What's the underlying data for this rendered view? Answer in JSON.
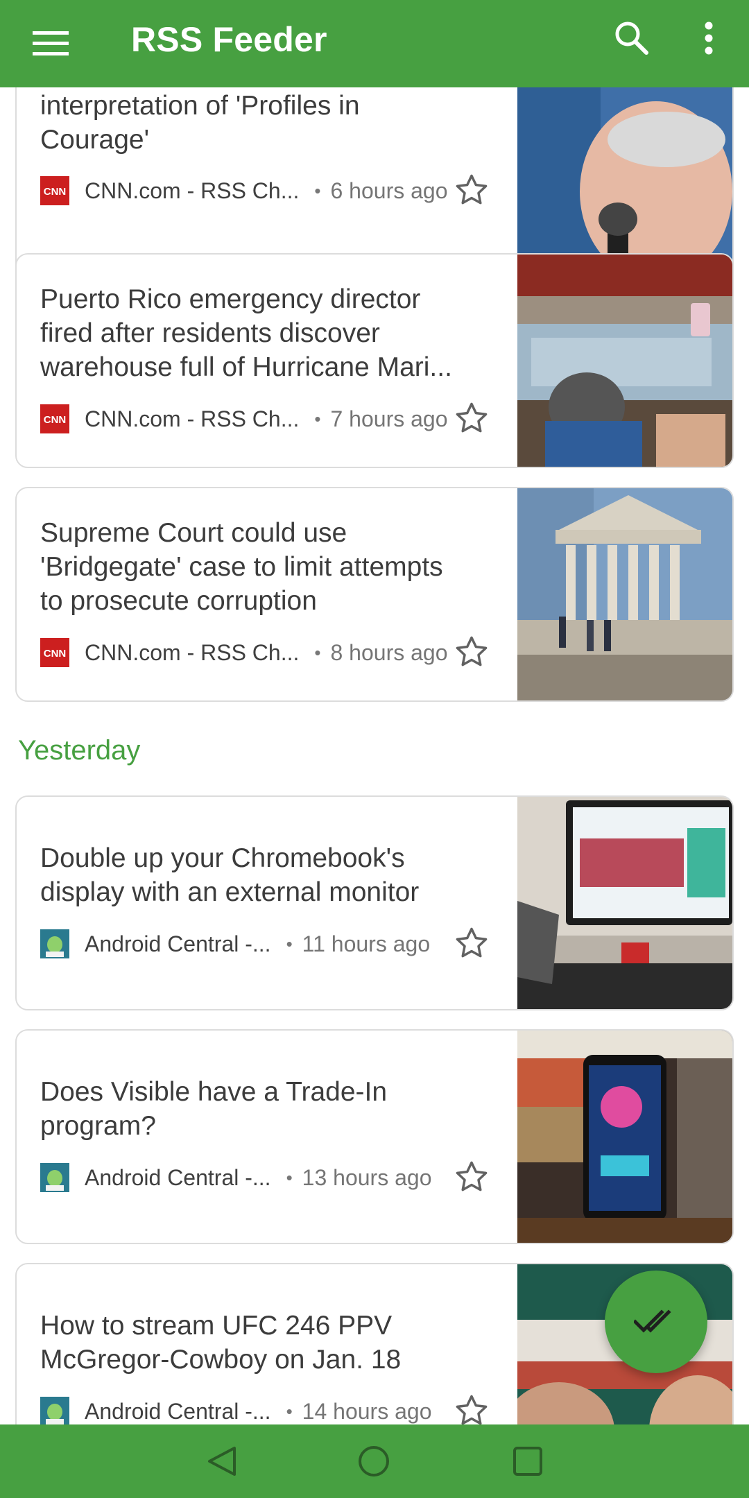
{
  "app": {
    "title": "RSS Feeder"
  },
  "colors": {
    "primary": "#47a041",
    "headline_text": "#3c3c3c",
    "meta_text": "#757575",
    "cnn_red": "#cc1f1f",
    "android_teal": "#2a7a8f"
  },
  "icons": {
    "menu": "menu-icon",
    "search": "search-icon",
    "more": "more-vert-icon",
    "star": "star-outline-icon",
    "fab": "done-all-icon",
    "nav_back": "back-triangle-icon",
    "nav_home": "home-circle-icon",
    "nav_recents": "recents-square-icon"
  },
  "feed": {
    "section_yesterday": "Yesterday",
    "articles": [
      {
        "line1": "interpretation of 'Profiles in",
        "line2": "Courage'",
        "source": "CNN.com - RSS Ch...",
        "time": "6 hours ago",
        "source_icon": "cnn-logo-icon"
      },
      {
        "line1": "Puerto Rico emergency director",
        "line2": "fired after residents discover",
        "line3": "warehouse full of Hurricane Mari...",
        "source": "CNN.com - RSS Ch...",
        "time": "7 hours ago",
        "source_icon": "cnn-logo-icon"
      },
      {
        "line1": "Supreme Court could use",
        "line2": "'Bridgegate' case to limit attempts",
        "line3": "to prosecute corruption",
        "source": "CNN.com - RSS Ch...",
        "time": "8 hours ago",
        "source_icon": "cnn-logo-icon"
      },
      {
        "line1": "Double up your Chromebook's",
        "line2": "display with an external monitor",
        "source": "Android Central -...",
        "time": "11 hours ago",
        "source_icon": "android-central-logo-icon"
      },
      {
        "line1": "Does Visible have a Trade-In",
        "line2": "program?",
        "source": "Android Central -...",
        "time": "13 hours ago",
        "source_icon": "android-central-logo-icon"
      },
      {
        "line1": "How to stream UFC 246 PPV",
        "line2": "McGregor-Cowboy on Jan. 18",
        "source": "Android Central -...",
        "time": "14 hours ago",
        "source_icon": "android-central-logo-icon"
      }
    ]
  }
}
